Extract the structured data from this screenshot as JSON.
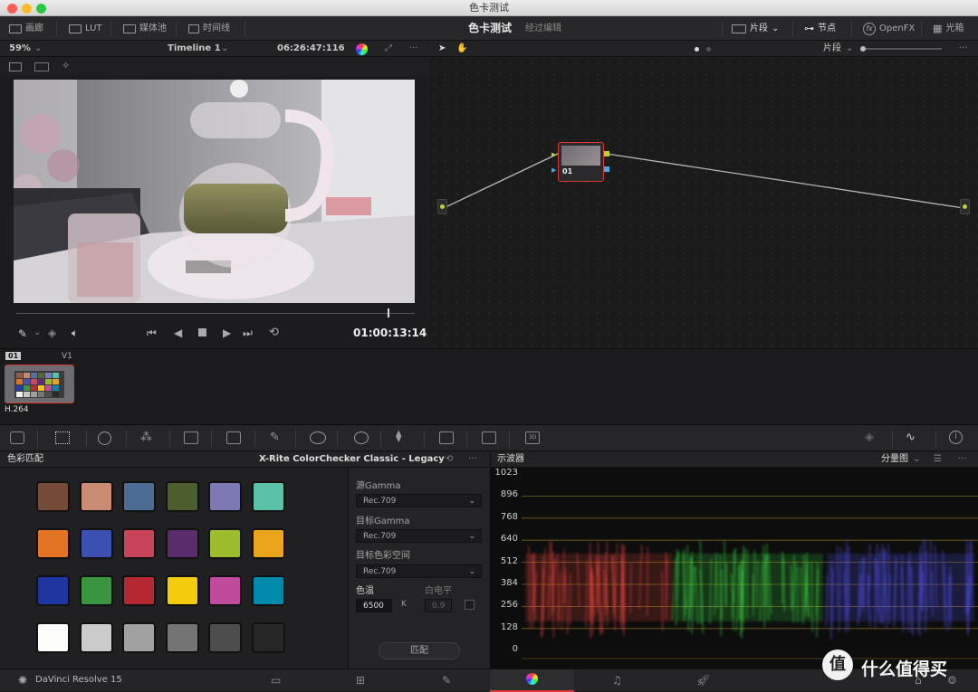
{
  "window": {
    "title": "色卡测试"
  },
  "topbar": {
    "left_items": [
      "画廊",
      "LUT",
      "媒体池",
      "时间线"
    ],
    "project_name": "色卡测试",
    "project_status": "经过编辑",
    "right_items": [
      "片段",
      "节点",
      "OpenFX",
      "光箱"
    ]
  },
  "viewer": {
    "zoom": "59%",
    "timeline_name": "Timeline 1",
    "source_timecode": "06:26:47:116",
    "record_timecode": "01:00:13:14"
  },
  "node_editor": {
    "mode_label": "片段",
    "node_label": "01"
  },
  "clips": [
    {
      "index": "01",
      "track": "V1",
      "codec": "H.264"
    }
  ],
  "color_match": {
    "panel_title": "色彩匹配",
    "chart_name": "X-Rite ColorChecker Classic - Legacy",
    "source_gamma_label": "源Gamma",
    "source_gamma_value": "Rec.709",
    "target_gamma_label": "目标Gamma",
    "target_gamma_value": "Rec.709",
    "target_colorspace_label": "目标色彩空间",
    "target_colorspace_value": "Rec.709",
    "temp_label": "色温",
    "temp_value": "6500",
    "temp_unit": "K",
    "white_level_label": "白电平",
    "white_level_value": "0.9",
    "match_button": "匹配",
    "swatch_colors": [
      "#744a38",
      "#c98b72",
      "#4c6c93",
      "#4c5d2e",
      "#7c79b3",
      "#5ac0a6",
      "#e37424",
      "#3b50b0",
      "#c74459",
      "#5a2c6c",
      "#9dbd2f",
      "#eba51d",
      "#1f35a0",
      "#3b9540",
      "#b32830",
      "#f4cb0d",
      "#c04a9b",
      "#008aab",
      "#fcfcfa",
      "#cbcbcb",
      "#a1a1a1",
      "#747474",
      "#4d4d4d",
      "#262626"
    ]
  },
  "scope": {
    "panel_title": "示波器",
    "mode": "分量图",
    "levels": [
      "1023",
      "896",
      "768",
      "640",
      "512",
      "384",
      "256",
      "128",
      "0"
    ]
  },
  "bottombar": {
    "app_name": "DaVinci Resolve 15"
  },
  "watermark": {
    "text": "什么值得买",
    "logo": "值"
  }
}
